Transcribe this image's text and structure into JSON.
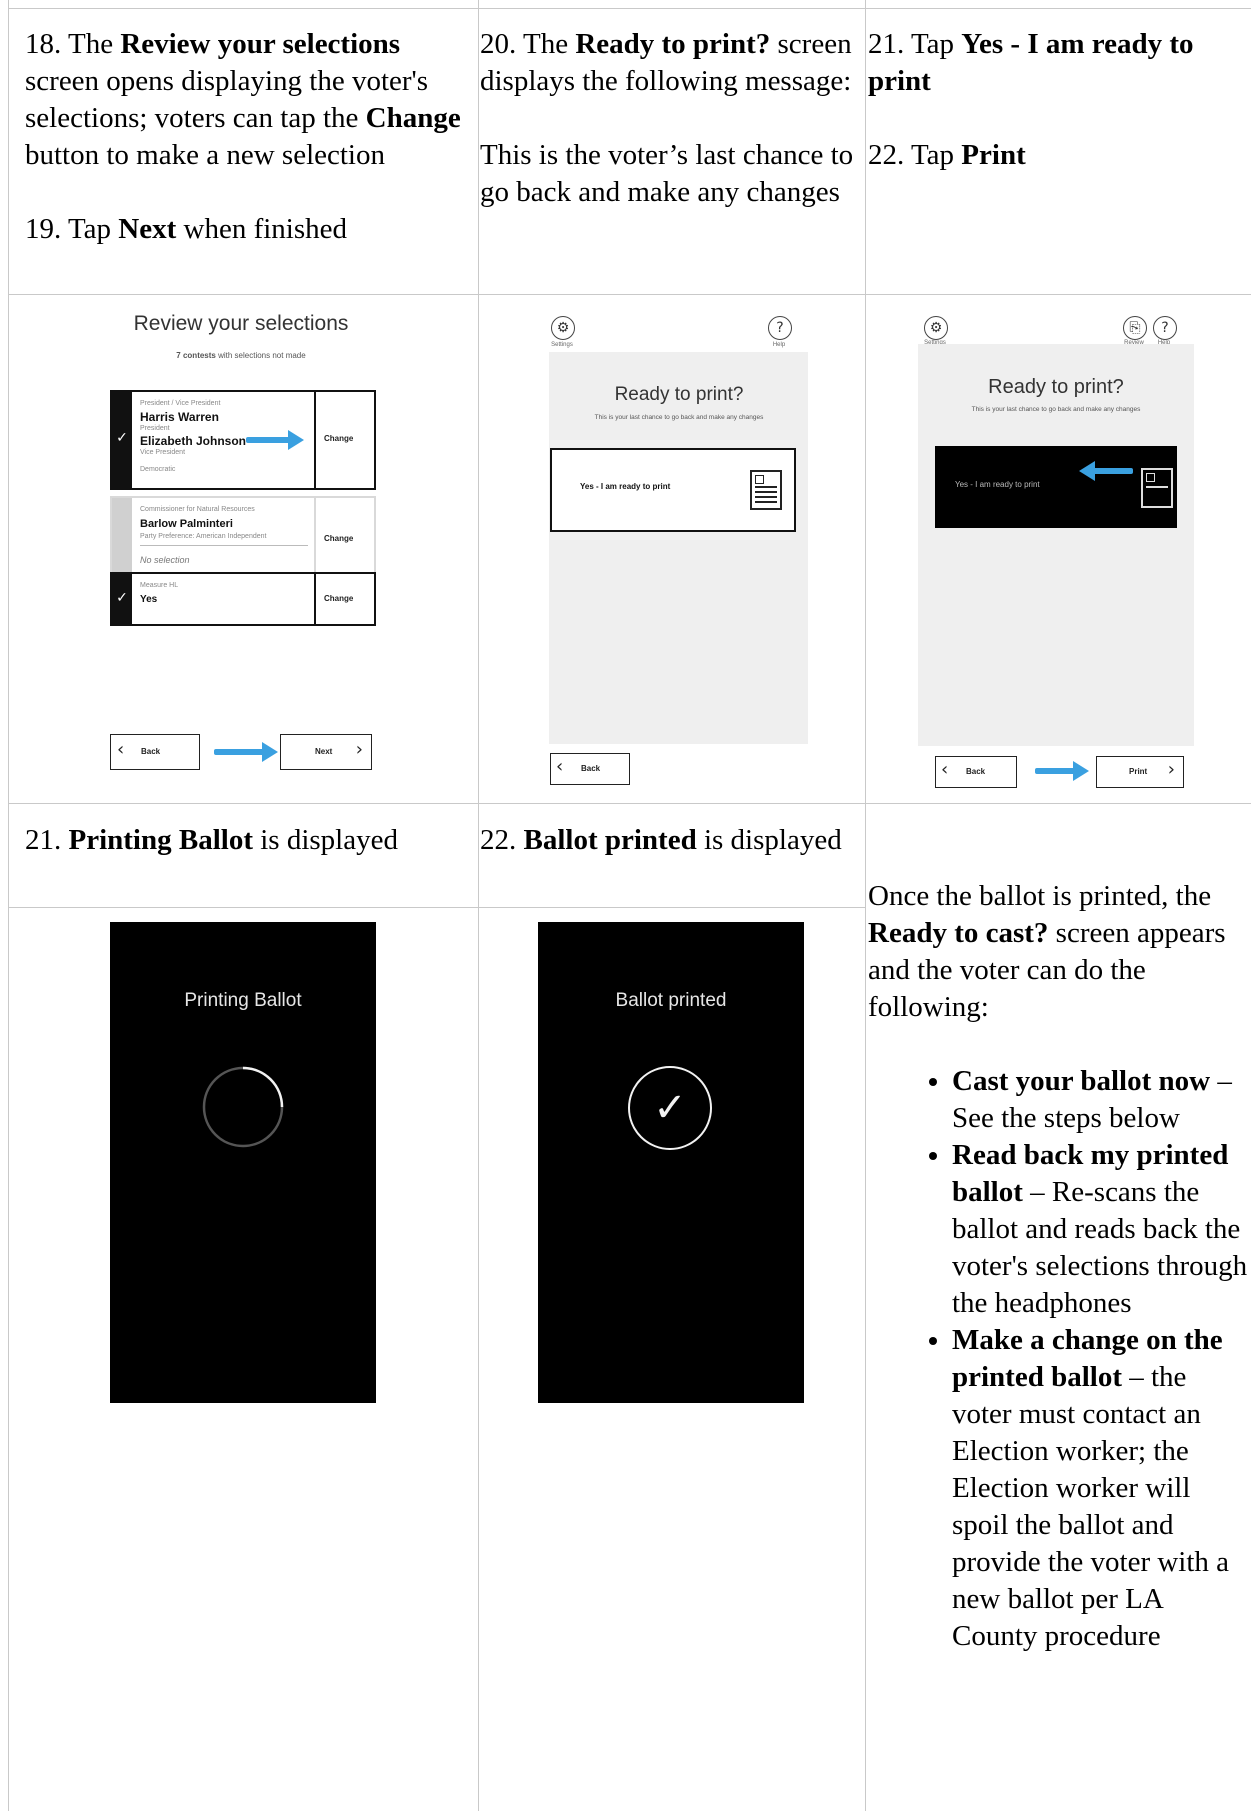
{
  "row1": {
    "col1": {
      "p1": {
        "num": "18. The ",
        "b1": "Review your selections",
        "t1": " screen opens displaying the voter's selections; voters can tap the ",
        "b2": "Change",
        "t2": " button to make a new selection"
      },
      "p2": {
        "num": "19. Tap ",
        "b1": "Next",
        "t1": " when finished"
      }
    },
    "col2": {
      "p1": {
        "num": "20. The ",
        "b1": "Ready to print?",
        "t1": " screen displays the following message:"
      },
      "p2": "This is the voter’s last chance to go back and make any changes"
    },
    "col3": {
      "p1": {
        "num": "21. Tap ",
        "b1": "Yes - I am ready to print"
      },
      "p2": {
        "num": "22. Tap ",
        "b1": "Print"
      }
    }
  },
  "review_screen": {
    "title": "Review your selections",
    "subtitle_bold": "7 contests",
    "subtitle_rest": " with selections not made",
    "contests": [
      {
        "label": "President / Vice President",
        "name1": "Harris Warren",
        "role1": "President",
        "name2": "Elizabeth Johnson",
        "role2": "Vice President",
        "party": "Democratic",
        "change": "Change",
        "checked": true
      },
      {
        "label": "Commissioner for Natural Resources",
        "name1": "Barlow Palminteri",
        "role1": "Party Preference: American Independent",
        "no_selection": "No selection",
        "change": "Change",
        "checked": false
      },
      {
        "label": "Measure HL",
        "name1": "Yes",
        "change": "Change",
        "checked": true
      }
    ],
    "back": "Back",
    "next": "Next",
    "check_glyph": "✓"
  },
  "ready_screen": {
    "settings_caption": "Settings",
    "help_caption": "Help",
    "help_glyph": "?",
    "title": "Ready to print?",
    "subtitle": "This is your last chance to go back and make any changes",
    "yes_button": "Yes - I am ready to print",
    "back": "Back"
  },
  "ready_screen_selected": {
    "settings_caption": "Settings",
    "review_caption": "Review",
    "help_caption": "Help",
    "help_glyph": "?",
    "title": "Ready to print?",
    "subtitle": "This is your last chance to go back and make any changes",
    "yes_button": "Yes - I am ready to print",
    "back": "Back",
    "print": "Print"
  },
  "row3": {
    "col1": {
      "num": "21. ",
      "b1": "Printing Ballot",
      "t1": " is displayed"
    },
    "col2": {
      "num": "22. ",
      "b1": "Ballot printed",
      "t1": " is displayed"
    },
    "col3": {
      "intro1": "Once the ballot is printed, the ",
      "intro_b": "Ready to cast?",
      "intro2": " screen appears and the voter can do the following:",
      "options": [
        {
          "b": "Cast your ballot now",
          "t": " – See the steps below"
        },
        {
          "b": "Read back my printed ballot",
          "t": " – Re-scans the ballot and reads back the voter's selections through the headphones"
        },
        {
          "b": "Make a change on the printed ballot",
          "t": " – the voter must contact an Election worker; the Election worker will spoil the ballot and provide the voter with a new ballot per LA County procedure"
        }
      ]
    }
  },
  "printing_screen": {
    "title": "Printing Ballot"
  },
  "printed_screen": {
    "title": "Ballot printed",
    "check_glyph": "✓"
  },
  "colors": {
    "arrow": "#3aa0e0",
    "border": "#c9c9c9",
    "dark_screen": "#000000"
  }
}
